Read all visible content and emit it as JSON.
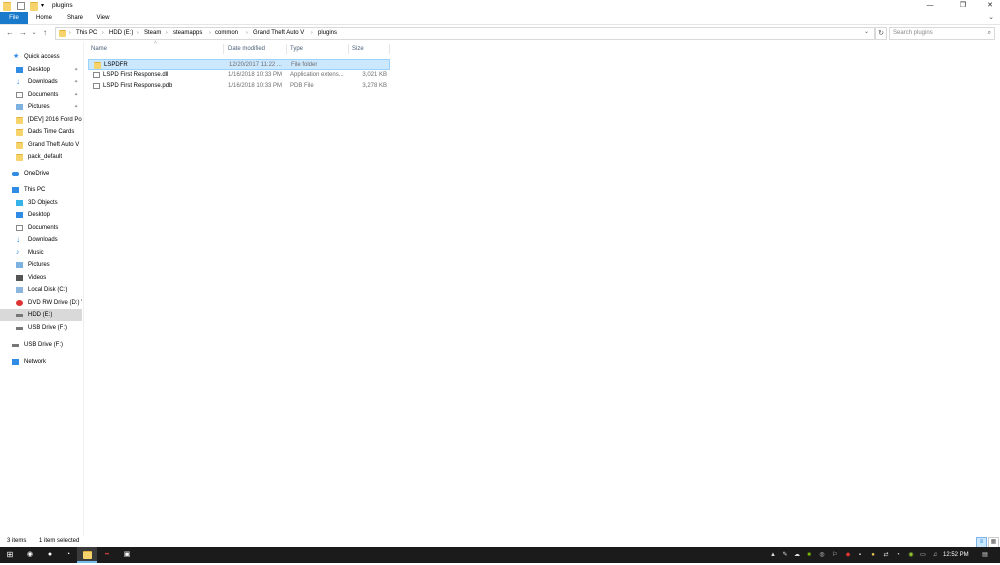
{
  "window": {
    "title": "plugins",
    "minimize": "—",
    "maximize": "❐",
    "close": "✕"
  },
  "ribbon": {
    "tabs": [
      "File",
      "Home",
      "Share",
      "View"
    ],
    "help": "?",
    "collapse": "⌄"
  },
  "address": {
    "back": "←",
    "forward": "→",
    "recent": "⌄",
    "up": "↑",
    "crumbs": [
      "This PC",
      "HDD (E:)",
      "Steam",
      "steamapps",
      "common",
      "Grand Theft Auto V",
      "plugins"
    ],
    "refresh": "↻",
    "dropdown": "⌄"
  },
  "search": {
    "placeholder": "Search plugins",
    "icon": "⌕"
  },
  "nav": {
    "items": [
      {
        "label": "Quick access",
        "icon": "star-icon",
        "pinned": false
      },
      {
        "label": "Desktop",
        "icon": "desktop-icon",
        "pinned": true
      },
      {
        "label": "Downloads",
        "icon": "download-icon",
        "pinned": true
      },
      {
        "label": "Documents",
        "icon": "documents-icon",
        "pinned": true
      },
      {
        "label": "Pictures",
        "icon": "pictures-icon",
        "pinned": true
      },
      {
        "label": "[DEV] 2016 Ford Pol",
        "icon": "folder-icon",
        "pinned": false
      },
      {
        "label": "Dads Time Cards",
        "icon": "folder-icon",
        "pinned": false
      },
      {
        "label": "Grand Theft Auto V",
        "icon": "folder-icon",
        "pinned": false
      },
      {
        "label": "pack_default",
        "icon": "folder-icon",
        "pinned": false
      },
      {
        "label": "OneDrive",
        "icon": "cloud-icon",
        "pinned": false
      },
      {
        "label": "This PC",
        "icon": "computer-icon",
        "pinned": false
      },
      {
        "label": "3D Objects",
        "icon": "cube-icon",
        "pinned": false
      },
      {
        "label": "Desktop",
        "icon": "desktop-icon",
        "pinned": false
      },
      {
        "label": "Documents",
        "icon": "documents-icon",
        "pinned": false
      },
      {
        "label": "Downloads",
        "icon": "download-icon",
        "pinned": false
      },
      {
        "label": "Music",
        "icon": "music-icon",
        "pinned": false
      },
      {
        "label": "Pictures",
        "icon": "pictures-icon",
        "pinned": false
      },
      {
        "label": "Videos",
        "icon": "video-icon",
        "pinned": false
      },
      {
        "label": "Local Disk (C:)",
        "icon": "drive-icon",
        "pinned": false
      },
      {
        "label": "DVD RW Drive (D:) V",
        "icon": "dvd-icon",
        "pinned": false
      },
      {
        "label": "HDD (E:)",
        "icon": "drive-icon",
        "pinned": false,
        "selected": true
      },
      {
        "label": "USB Drive (F:)",
        "icon": "usb-drive-icon",
        "pinned": false
      },
      {
        "label": "USB Drive (F:)",
        "icon": "usb-drive-icon",
        "pinned": false
      },
      {
        "label": "Network",
        "icon": "network-icon",
        "pinned": false
      }
    ],
    "pin_glyph": "📌"
  },
  "columns": [
    "Name",
    "Date modified",
    "Type",
    "Size"
  ],
  "files": [
    {
      "name": "LSPDFR",
      "date": "12/20/2017 11:22 ...",
      "type": "File folder",
      "size": "",
      "selected": true
    },
    {
      "name": "LSPD First Response.dll",
      "date": "1/16/2018 10:33 PM",
      "type": "Application extens...",
      "size": "3,021 KB"
    },
    {
      "name": "LSPD First Response.pdb",
      "date": "1/16/2018 10:33 PM",
      "type": "PDB File",
      "size": "3,278 KB"
    }
  ],
  "status": {
    "count": "3 items",
    "selected": "1 item selected"
  },
  "taskbar": {
    "start": "⊞",
    "clock": "12:52 PM"
  },
  "colors": {
    "accent": "#1979ca",
    "selection": "#cce8ff",
    "taskbar": "#1b1b1b"
  }
}
